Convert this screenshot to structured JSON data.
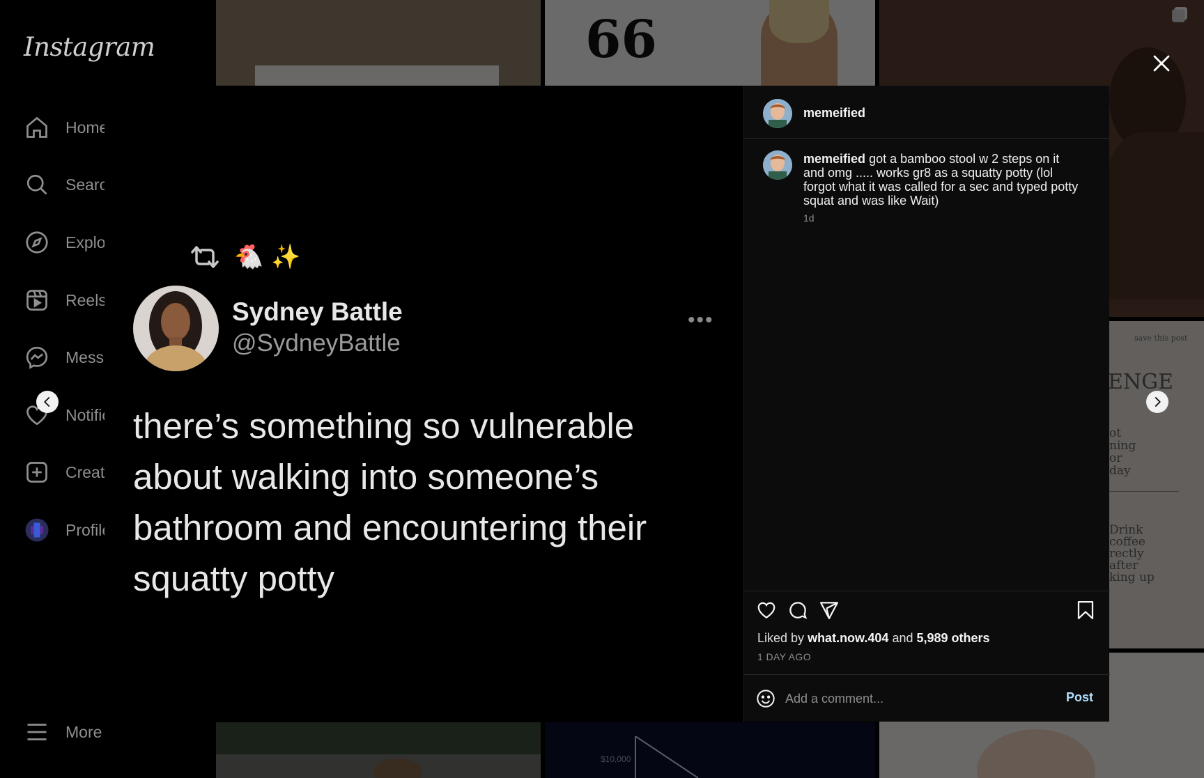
{
  "app": {
    "logo": "Instagram"
  },
  "sidebar": {
    "items": [
      {
        "label": "Home",
        "icon": "home-icon"
      },
      {
        "label": "Search",
        "icon": "search-icon"
      },
      {
        "label": "Explore",
        "icon": "compass-icon"
      },
      {
        "label": "Reels",
        "icon": "reels-icon"
      },
      {
        "label": "Messages",
        "icon": "messenger-icon"
      },
      {
        "label": "Notifications",
        "icon": "heart-icon"
      },
      {
        "label": "Create",
        "icon": "plus-square-icon"
      },
      {
        "label": "Profile",
        "icon": "profile-avatar"
      }
    ],
    "more_label": "More"
  },
  "background": {
    "quote_mark": "66",
    "tiles_text": {
      "save_post": "save this post",
      "challenge": "ENGE",
      "tip1": "ot\nning\nor\nday",
      "tip2": "Drink\ncoffee\nrectly\nafter\nking up",
      "chart_value": "$10,000"
    }
  },
  "post": {
    "author": "memeified",
    "caption_user": "memeified",
    "caption": "got a bamboo stool w 2 steps on it and omg ..... works gr8 as a squatty potty (lol forgot what it was called for a sec and typed potty squat and was like Wait)",
    "caption_age": "1d",
    "liked_by_prefix": "Liked by",
    "liked_by_user": "what.now.404",
    "liked_by_joiner": "and",
    "liked_by_others": "5,989 others",
    "date": "1 DAY AGO",
    "comment_placeholder": "Add a comment...",
    "post_button": "Post"
  },
  "tweet": {
    "emojis": "🐔 ✨",
    "name": "Sydney Battle",
    "handle": "@SydneyBattle",
    "more": "•••",
    "text": "there’s something so vulnerable about walking into someone’s bathroom and encountering their squatty potty"
  },
  "colors": {
    "background": "#000000",
    "panel": "#0c0c0c",
    "post_button": "#b2dffc",
    "muted_text": "#8e8e8e"
  }
}
